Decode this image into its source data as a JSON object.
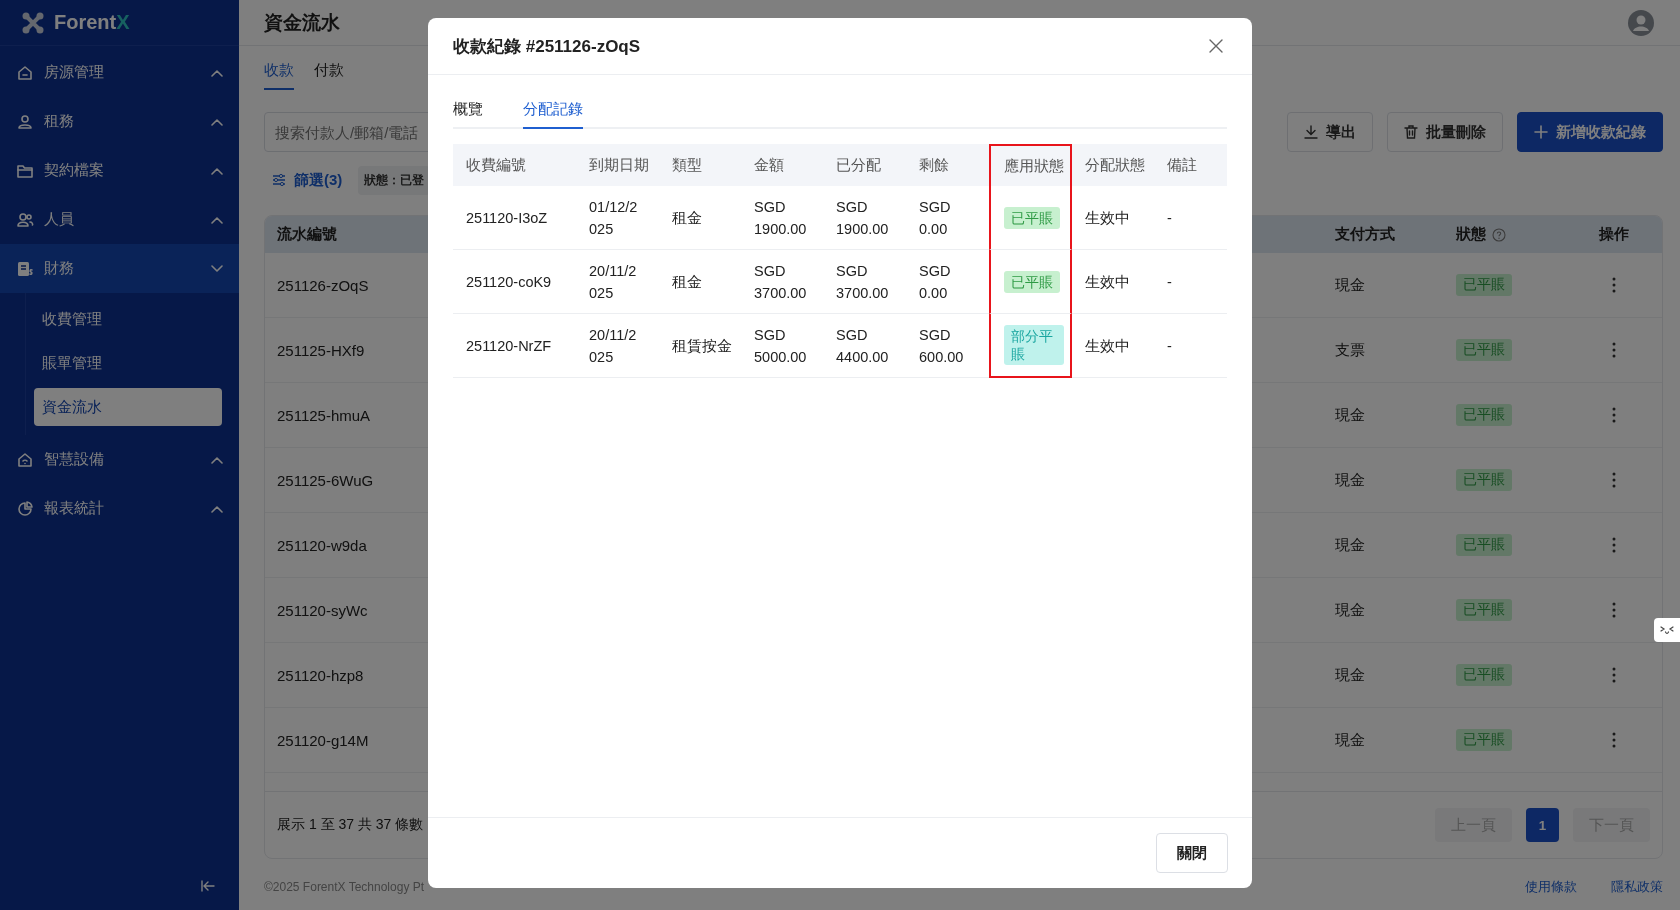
{
  "sidebar": {
    "logo": {
      "text": "Forent",
      "accent": "X"
    },
    "items": [
      {
        "label": "房源管理",
        "expanded": false,
        "selected": false
      },
      {
        "label": "租務",
        "expanded": false,
        "selected": false
      },
      {
        "label": "契約檔案",
        "expanded": false,
        "selected": false
      },
      {
        "label": "人員",
        "expanded": false,
        "selected": false
      },
      {
        "label": "財務",
        "expanded": true,
        "selected": true,
        "children": [
          {
            "label": "收費管理",
            "selected": false
          },
          {
            "label": "賬單管理",
            "selected": false
          },
          {
            "label": "資金流水",
            "selected": true
          }
        ]
      },
      {
        "label": "智慧設備",
        "expanded": false,
        "selected": false
      },
      {
        "label": "報表統計",
        "expanded": false,
        "selected": false
      }
    ]
  },
  "page": {
    "title": "資金流水",
    "tabs": [
      {
        "label": "收款",
        "selected": true
      },
      {
        "label": "付款",
        "selected": false
      }
    ],
    "search": {
      "placeholder": "搜索付款人/郵箱/電話"
    },
    "buttons": [
      {
        "label": "導出",
        "kind": "export"
      },
      {
        "label": "批量刪除",
        "kind": "delete"
      },
      {
        "label": "新增收款紀錄",
        "kind": "add"
      }
    ],
    "filter": {
      "label": "篩選(3)",
      "chip": "狀態：已登"
    },
    "table": {
      "columns": [
        "流水編號",
        "支付方式",
        "狀態",
        "操作"
      ],
      "rows": [
        {
          "id": "251126-zOqS",
          "payment": "現金",
          "status": {
            "text": "已平賬",
            "kind": "settled"
          }
        },
        {
          "id": "251125-HXf9",
          "payment": "支票",
          "status": {
            "text": "已平賬",
            "kind": "settled"
          }
        },
        {
          "id": "251125-hmuA",
          "payment": "現金",
          "status": {
            "text": "已平賬",
            "kind": "settled"
          }
        },
        {
          "id": "251125-6WuG",
          "payment": "現金",
          "status": {
            "text": "已平賬",
            "kind": "settled"
          }
        },
        {
          "id": "251120-w9da",
          "payment": "現金",
          "status": {
            "text": "已平賬",
            "kind": "settled"
          }
        },
        {
          "id": "251120-syWc",
          "payment": "現金",
          "status": {
            "text": "已平賬",
            "kind": "settled"
          }
        },
        {
          "id": "251120-hzp8",
          "payment": "現金",
          "status": {
            "text": "已平賬",
            "kind": "settled"
          }
        },
        {
          "id": "251120-g14M",
          "payment": "現金",
          "status": {
            "text": "已平賬",
            "kind": "settled"
          }
        }
      ],
      "summary": "展示 1 至 37 共 37 條數",
      "pagination": {
        "prev": "上一頁",
        "pages": [
          {
            "label": "1",
            "selected": true
          }
        ],
        "next": "下一頁"
      }
    },
    "footer": {
      "copyright": "©2025 ForentX Technology Pt",
      "links": [
        "使用條款",
        "隱私政策"
      ]
    }
  },
  "modal": {
    "title": "收款紀錄 #251126-zOqS",
    "tabs": [
      {
        "label": "概覽",
        "selected": false
      },
      {
        "label": "分配記錄",
        "selected": true
      }
    ],
    "table": {
      "columns": [
        {
          "label": "收費編號",
          "highlighted": false
        },
        {
          "label": "到期日期",
          "highlighted": false
        },
        {
          "label": "類型",
          "highlighted": false
        },
        {
          "label": "金額",
          "highlighted": false
        },
        {
          "label": "已分配",
          "highlighted": false
        },
        {
          "label": "剩餘",
          "highlighted": false
        },
        {
          "label": "應用狀態",
          "highlighted": true
        },
        {
          "label": "分配狀態",
          "highlighted": false
        },
        {
          "label": "備註",
          "highlighted": false
        }
      ],
      "rows": [
        {
          "cells": [
            "251120-I3oZ",
            "01/12/2025",
            "租金",
            "SGD 1900.00",
            "SGD 1900.00",
            "SGD 0.00",
            {
              "text": "已平賬",
              "kind": "settled"
            },
            "生效中",
            "-"
          ]
        },
        {
          "cells": [
            "251120-coK9",
            "20/11/2025",
            "租金",
            "SGD 3700.00",
            "SGD 3700.00",
            "SGD 0.00",
            {
              "text": "已平賬",
              "kind": "settled"
            },
            "生效中",
            "-"
          ]
        },
        {
          "cells": [
            "251120-NrZF",
            "20/11/2025",
            "租賃按金",
            "SGD 5000.00",
            "SGD 4400.00",
            "SGD 600.00",
            {
              "text": "部分平賬",
              "kind": "partial"
            },
            "生效中",
            "-"
          ]
        }
      ]
    },
    "close_button": "關閉"
  }
}
